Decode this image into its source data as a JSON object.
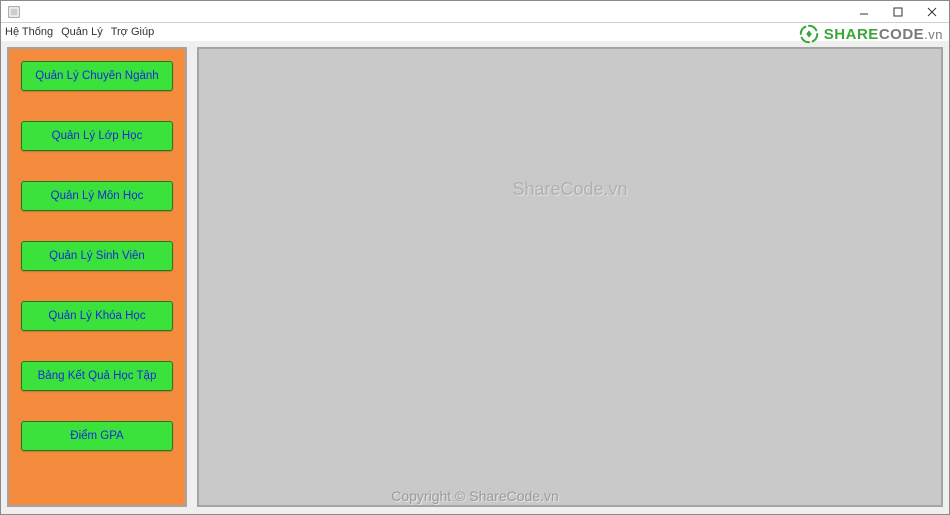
{
  "window": {
    "title": "",
    "controls": {
      "minimize": "−",
      "maximize": "☐",
      "close": "✕"
    }
  },
  "menubar": {
    "items": [
      {
        "label": "Hệ Thống"
      },
      {
        "label": "Quản Lý"
      },
      {
        "label": "Trợ Giúp"
      }
    ]
  },
  "sidebar": {
    "buttons": [
      {
        "label": "Quản Lý Chuyên Ngành"
      },
      {
        "label": "Quản Lý Lớp Học"
      },
      {
        "label": "Quản Lý Môn Học"
      },
      {
        "label": "Quản Lý Sinh Viên"
      },
      {
        "label": "Quản Lý Khóa Học"
      },
      {
        "label": "Bảng Kết Quả Học Tập"
      },
      {
        "label": "Điểm GPA"
      }
    ]
  },
  "watermarks": {
    "center": "ShareCode.vn",
    "bottom": "Copyright © ShareCode.vn",
    "logo_share": "SHARE",
    "logo_code": "CODE",
    "logo_vn": ".vn"
  }
}
